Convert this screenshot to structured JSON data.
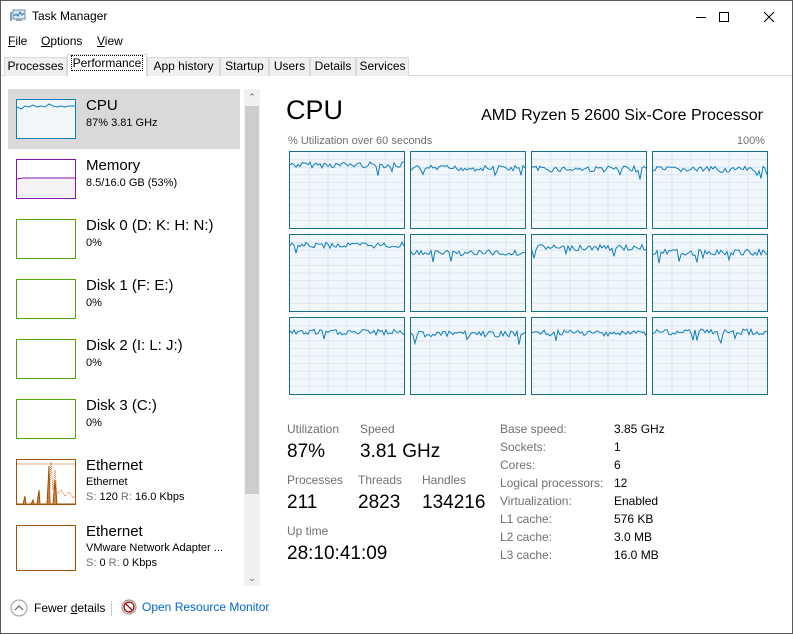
{
  "window": {
    "title": "Task Manager",
    "controls": {
      "minimize": "minimize-icon",
      "maximize": "maximize-icon",
      "close": "close-icon"
    }
  },
  "menu": [
    {
      "label": "File",
      "accel": "F",
      "rest": "ile"
    },
    {
      "label": "Options",
      "accel": "O",
      "rest": "ptions"
    },
    {
      "label": "View",
      "accel": "V",
      "rest": "iew"
    }
  ],
  "tabs": [
    {
      "label": "Processes",
      "active": false
    },
    {
      "label": "Performance",
      "active": true
    },
    {
      "label": "App history",
      "active": false
    },
    {
      "label": "Startup",
      "active": false
    },
    {
      "label": "Users",
      "active": false
    },
    {
      "label": "Details",
      "active": false
    },
    {
      "label": "Services",
      "active": false
    }
  ],
  "sidebar": {
    "items": [
      {
        "name": "CPU",
        "line1": "87%  3.81 GHz",
        "color": "#117dbb",
        "selected": true
      },
      {
        "name": "Memory",
        "line1": "8.5/16.0 GB (53%)",
        "color": "#8b12ae",
        "selected": false
      },
      {
        "name": "Disk 0 (D: K: H: N:)",
        "line1": "0%",
        "color": "#4da60c",
        "selected": false
      },
      {
        "name": "Disk 1 (F: E:)",
        "line1": "0%",
        "color": "#4da60c",
        "selected": false
      },
      {
        "name": "Disk 2 (I: L: J:)",
        "line1": "0%",
        "color": "#4da60c",
        "selected": false
      },
      {
        "name": "Disk 3 (C:)",
        "line1": "0%",
        "color": "#4da60c",
        "selected": false
      },
      {
        "name": "Ethernet",
        "line1": "Ethernet",
        "send_label": "S:",
        "send": "120",
        "recv_label": "R:",
        "recv": "16.0 Kbps",
        "color": "#a74f01",
        "selected": false
      },
      {
        "name": "Ethernet",
        "line1": "VMware Network Adapter ...",
        "send_label": "S:",
        "send": "0",
        "recv_label": "R:",
        "recv": "0 Kbps",
        "color": "#a74f01",
        "selected": false
      }
    ]
  },
  "main": {
    "title": "CPU",
    "model": "AMD Ryzen 5 2600 Six-Core Processor",
    "graph_label": "% Utilization over 60 seconds",
    "graph_max": "100%",
    "logical_graphs": 12,
    "stats": {
      "utilization_label": "Utilization",
      "utilization": "87%",
      "speed_label": "Speed",
      "speed": "3.81 GHz",
      "processes_label": "Processes",
      "processes": "211",
      "threads_label": "Threads",
      "threads": "2823",
      "handles_label": "Handles",
      "handles": "134216",
      "uptime_label": "Up time",
      "uptime": "28:10:41:09"
    },
    "specs": [
      {
        "label": "Base speed:",
        "value": "3.85 GHz"
      },
      {
        "label": "Sockets:",
        "value": "1"
      },
      {
        "label": "Cores:",
        "value": "6"
      },
      {
        "label": "Logical processors:",
        "value": "12"
      },
      {
        "label": "Virtualization:",
        "value": "Enabled"
      },
      {
        "label": "L1 cache:",
        "value": "576 KB"
      },
      {
        "label": "L2 cache:",
        "value": "3.0 MB"
      },
      {
        "label": "L3 cache:",
        "value": "16.0 MB"
      }
    ]
  },
  "footer": {
    "fewer_details": "Fewer details",
    "fewer_pre": "Fewer ",
    "fewer_accel": "d",
    "fewer_post": "etails",
    "resource_monitor": "Open Resource Monitor",
    "link_color": "#0066cc"
  }
}
